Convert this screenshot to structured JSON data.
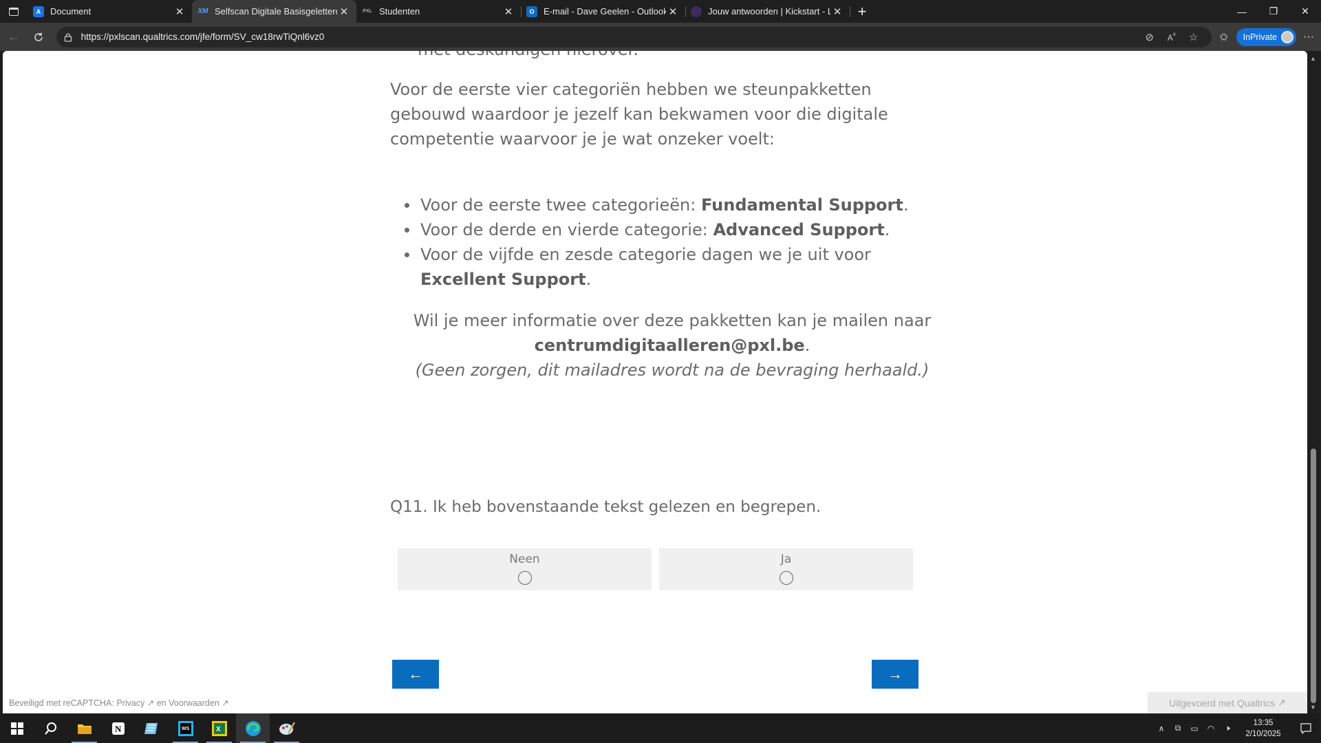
{
  "browser": {
    "tabs": [
      {
        "title": "Document",
        "favicon": "A",
        "favicon_color": "#1a73e8",
        "active": false
      },
      {
        "title": "Selfscan Digitale Basisgeletterdhe",
        "favicon": "XM",
        "favicon_color": "#1d6fe0",
        "active": true
      },
      {
        "title": "Studenten",
        "favicon": "PXL",
        "favicon_color": "#555555",
        "active": false
      },
      {
        "title": "E-mail - Dave Geelen - Outlook",
        "favicon": "O",
        "favicon_color": "#0f6cbd",
        "active": false
      },
      {
        "title": "Jouw antwoorden | Kickstart - Len",
        "favicon": "",
        "favicon_color": "#3a2d5c",
        "active": false
      }
    ],
    "url": "https://pxlscan.qualtrics.com/jfe/form/SV_cw18rwTiQnl6vz0",
    "inprivate_label": "InPrivate"
  },
  "survey": {
    "cut_line": "met deskundigen hierover.",
    "intro": "Voor de eerste vier categoriën hebben we steunpakketten gebouwd waardoor je jezelf kan bekwamen voor die digitale competentie waarvoor je je wat onzeker voelt:",
    "bullets": [
      {
        "prefix": "Voor de eerste twee categorieën: ",
        "bold": "Fundamental Support",
        "suffix": "."
      },
      {
        "prefix": "Voor de derde en vierde categorie: ",
        "bold": "Advanced Support",
        "suffix": "."
      },
      {
        "prefix": "Voor de vijfde en zesde categorie dagen we je uit voor ",
        "bold": "Excellent Support",
        "suffix": "."
      }
    ],
    "mail_line": "Wil je meer informatie over deze pakketten kan je mailen naar",
    "email": "centrumdigitaalleren@pxl.be",
    "email_suffix": ".",
    "note": "(Geen zorgen, dit mailadres wordt na de bevraging herhaald.)",
    "question": "Q11. Ik heb bovenstaande tekst gelezen en begrepen.",
    "choices": [
      "Neen",
      "Ja"
    ],
    "back_button": "←",
    "next_button": "→",
    "recaptcha": {
      "prefix": "Beveiligd met reCAPTCHA: ",
      "privacy": "Privacy",
      "and": " en ",
      "terms": "Voorwaarden"
    },
    "powered_by": "Uitgevoerd met Qualtrics"
  },
  "taskbar": {
    "time": "13:35",
    "date": "2/10/2025"
  },
  "colors": {
    "accent_button": "#0a6cbc",
    "text": "#6b6b6b",
    "choice_bg": "#f0f0f0"
  }
}
